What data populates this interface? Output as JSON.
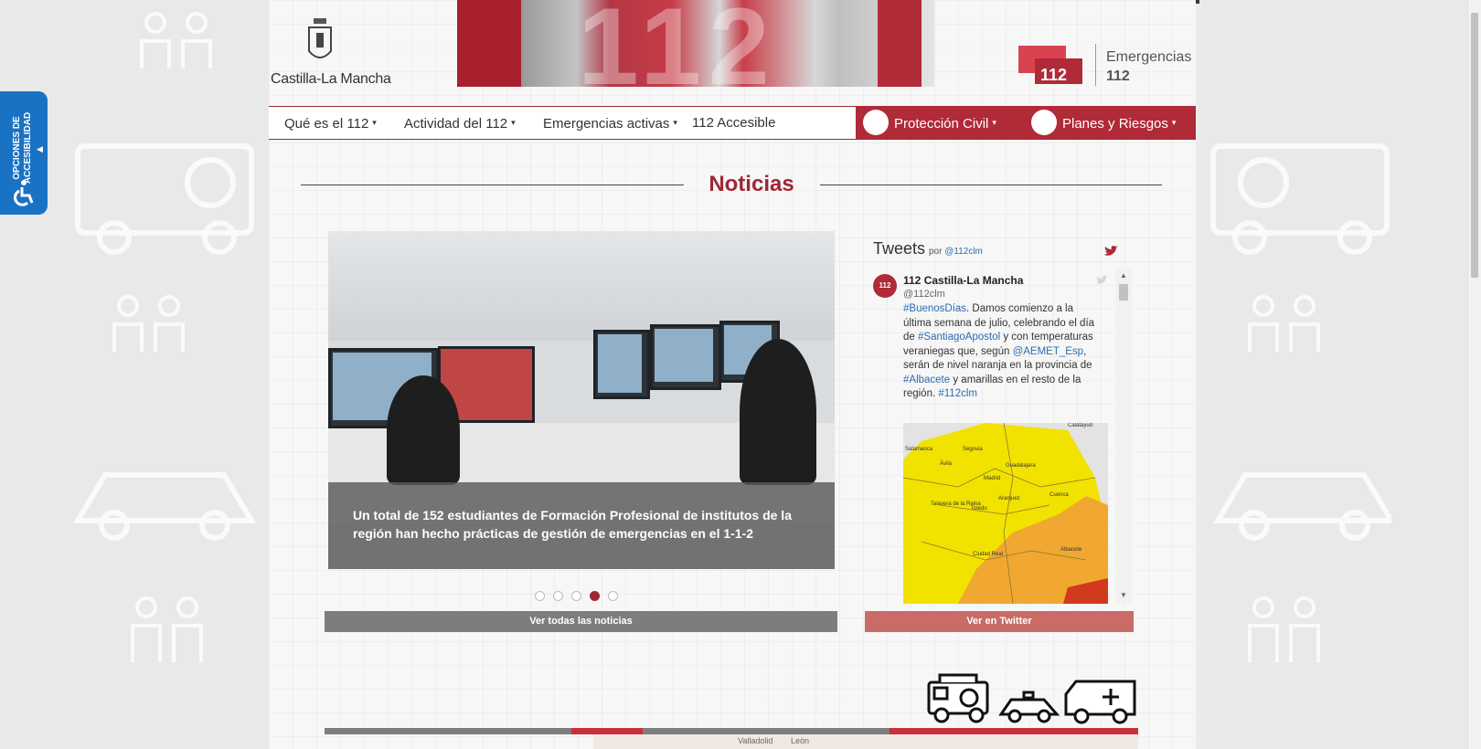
{
  "header": {
    "region_logo_text": "Castilla-La Mancha",
    "banner_text": "112",
    "emergencias_line1": "Emergencias",
    "emergencias_line2": "112",
    "logo_112_text": "112"
  },
  "nav": {
    "items": [
      {
        "label": "Qué es el 112",
        "dropdown": true
      },
      {
        "label": "Actividad del 112",
        "dropdown": true
      },
      {
        "label": "Emergencias activas",
        "dropdown": true
      },
      {
        "label": "112 Accesible",
        "dropdown": false
      }
    ],
    "red_items": [
      {
        "label": "Protección Civil",
        "dropdown": true
      },
      {
        "label": "Planes y Riesgos",
        "dropdown": true
      }
    ],
    "caret": "▾"
  },
  "section": {
    "title": "Noticias"
  },
  "carousel": {
    "caption": "Un total de 152 estudiantes de Formación Profesional de institutos de la región han hecho prácticas de gestión de emergencias en el 1-1-2",
    "slide_count": 5,
    "active_index": 3
  },
  "buttons": {
    "all_news": "Ver todas las noticias",
    "twitter": "Ver en Twitter"
  },
  "tweets": {
    "title": "Tweets",
    "by_prefix": "por",
    "by_handle": "@112clm",
    "author_name": "112 Castilla-La Mancha",
    "author_handle": "@112clm",
    "avatar_text": "112",
    "text_parts": [
      {
        "t": "#BuenosDías",
        "h": true
      },
      {
        "t": ". Damos comienzo a la última semana de julio, celebrando el día de ",
        "h": false
      },
      {
        "t": "#SantiagoApostol",
        "h": true
      },
      {
        "t": "  y con temperaturas veraniegas que, según ",
        "h": false
      },
      {
        "t": "@AEMET_Esp",
        "h": true
      },
      {
        "t": ", serán de nivel naranja en la provincia de ",
        "h": false
      },
      {
        "t": "#Albacete",
        "h": true
      },
      {
        "t": " y amarillas en el resto de la región. ",
        "h": false
      },
      {
        "t": "#112clm",
        "h": true
      }
    ],
    "map_labels": [
      "Salamanca",
      "Segovia",
      "Ávila",
      "Guadalajara",
      "Madrid",
      "Cuenca",
      "Talavera de la Reina",
      "Toledo",
      "Aranjuez",
      "Ciudad Real",
      "Albacete",
      "Calatayud"
    ]
  },
  "bottom_map": {
    "labels": [
      "Valladolid",
      "León"
    ]
  },
  "accessibility": {
    "label_line1": "OPCIONES DE",
    "label_line2": "ACCESIBILIDAD"
  },
  "colors": {
    "brand_red": "#b02a37",
    "title_red": "#a02633",
    "accessibility_blue": "#1a72c4",
    "button_grey": "#7d7d7d",
    "button_twitter": "#c96b67",
    "hashtag_blue": "#2b6cb0"
  },
  "icons": {
    "twitter": "twitter-bird-icon",
    "vehicles": [
      "fire-truck-icon",
      "police-car-icon",
      "ambulance-icon"
    ]
  }
}
